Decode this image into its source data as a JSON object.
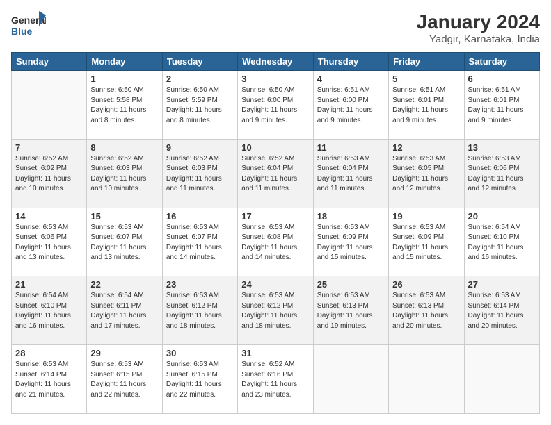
{
  "header": {
    "logo_general": "General",
    "logo_blue": "Blue",
    "title": "January 2024",
    "subtitle": "Yadgir, Karnataka, India"
  },
  "weekdays": [
    "Sunday",
    "Monday",
    "Tuesday",
    "Wednesday",
    "Thursday",
    "Friday",
    "Saturday"
  ],
  "weeks": [
    [
      {
        "day": "",
        "info": ""
      },
      {
        "day": "1",
        "info": "Sunrise: 6:50 AM\nSunset: 5:58 PM\nDaylight: 11 hours\nand 8 minutes."
      },
      {
        "day": "2",
        "info": "Sunrise: 6:50 AM\nSunset: 5:59 PM\nDaylight: 11 hours\nand 8 minutes."
      },
      {
        "day": "3",
        "info": "Sunrise: 6:50 AM\nSunset: 6:00 PM\nDaylight: 11 hours\nand 9 minutes."
      },
      {
        "day": "4",
        "info": "Sunrise: 6:51 AM\nSunset: 6:00 PM\nDaylight: 11 hours\nand 9 minutes."
      },
      {
        "day": "5",
        "info": "Sunrise: 6:51 AM\nSunset: 6:01 PM\nDaylight: 11 hours\nand 9 minutes."
      },
      {
        "day": "6",
        "info": "Sunrise: 6:51 AM\nSunset: 6:01 PM\nDaylight: 11 hours\nand 9 minutes."
      }
    ],
    [
      {
        "day": "7",
        "info": "Sunrise: 6:52 AM\nSunset: 6:02 PM\nDaylight: 11 hours\nand 10 minutes."
      },
      {
        "day": "8",
        "info": "Sunrise: 6:52 AM\nSunset: 6:03 PM\nDaylight: 11 hours\nand 10 minutes."
      },
      {
        "day": "9",
        "info": "Sunrise: 6:52 AM\nSunset: 6:03 PM\nDaylight: 11 hours\nand 11 minutes."
      },
      {
        "day": "10",
        "info": "Sunrise: 6:52 AM\nSunset: 6:04 PM\nDaylight: 11 hours\nand 11 minutes."
      },
      {
        "day": "11",
        "info": "Sunrise: 6:53 AM\nSunset: 6:04 PM\nDaylight: 11 hours\nand 11 minutes."
      },
      {
        "day": "12",
        "info": "Sunrise: 6:53 AM\nSunset: 6:05 PM\nDaylight: 11 hours\nand 12 minutes."
      },
      {
        "day": "13",
        "info": "Sunrise: 6:53 AM\nSunset: 6:06 PM\nDaylight: 11 hours\nand 12 minutes."
      }
    ],
    [
      {
        "day": "14",
        "info": "Sunrise: 6:53 AM\nSunset: 6:06 PM\nDaylight: 11 hours\nand 13 minutes."
      },
      {
        "day": "15",
        "info": "Sunrise: 6:53 AM\nSunset: 6:07 PM\nDaylight: 11 hours\nand 13 minutes."
      },
      {
        "day": "16",
        "info": "Sunrise: 6:53 AM\nSunset: 6:07 PM\nDaylight: 11 hours\nand 14 minutes."
      },
      {
        "day": "17",
        "info": "Sunrise: 6:53 AM\nSunset: 6:08 PM\nDaylight: 11 hours\nand 14 minutes."
      },
      {
        "day": "18",
        "info": "Sunrise: 6:53 AM\nSunset: 6:09 PM\nDaylight: 11 hours\nand 15 minutes."
      },
      {
        "day": "19",
        "info": "Sunrise: 6:53 AM\nSunset: 6:09 PM\nDaylight: 11 hours\nand 15 minutes."
      },
      {
        "day": "20",
        "info": "Sunrise: 6:54 AM\nSunset: 6:10 PM\nDaylight: 11 hours\nand 16 minutes."
      }
    ],
    [
      {
        "day": "21",
        "info": "Sunrise: 6:54 AM\nSunset: 6:10 PM\nDaylight: 11 hours\nand 16 minutes."
      },
      {
        "day": "22",
        "info": "Sunrise: 6:54 AM\nSunset: 6:11 PM\nDaylight: 11 hours\nand 17 minutes."
      },
      {
        "day": "23",
        "info": "Sunrise: 6:53 AM\nSunset: 6:12 PM\nDaylight: 11 hours\nand 18 minutes."
      },
      {
        "day": "24",
        "info": "Sunrise: 6:53 AM\nSunset: 6:12 PM\nDaylight: 11 hours\nand 18 minutes."
      },
      {
        "day": "25",
        "info": "Sunrise: 6:53 AM\nSunset: 6:13 PM\nDaylight: 11 hours\nand 19 minutes."
      },
      {
        "day": "26",
        "info": "Sunrise: 6:53 AM\nSunset: 6:13 PM\nDaylight: 11 hours\nand 20 minutes."
      },
      {
        "day": "27",
        "info": "Sunrise: 6:53 AM\nSunset: 6:14 PM\nDaylight: 11 hours\nand 20 minutes."
      }
    ],
    [
      {
        "day": "28",
        "info": "Sunrise: 6:53 AM\nSunset: 6:14 PM\nDaylight: 11 hours\nand 21 minutes."
      },
      {
        "day": "29",
        "info": "Sunrise: 6:53 AM\nSunset: 6:15 PM\nDaylight: 11 hours\nand 22 minutes."
      },
      {
        "day": "30",
        "info": "Sunrise: 6:53 AM\nSunset: 6:15 PM\nDaylight: 11 hours\nand 22 minutes."
      },
      {
        "day": "31",
        "info": "Sunrise: 6:52 AM\nSunset: 6:16 PM\nDaylight: 11 hours\nand 23 minutes."
      },
      {
        "day": "",
        "info": ""
      },
      {
        "day": "",
        "info": ""
      },
      {
        "day": "",
        "info": ""
      }
    ]
  ]
}
